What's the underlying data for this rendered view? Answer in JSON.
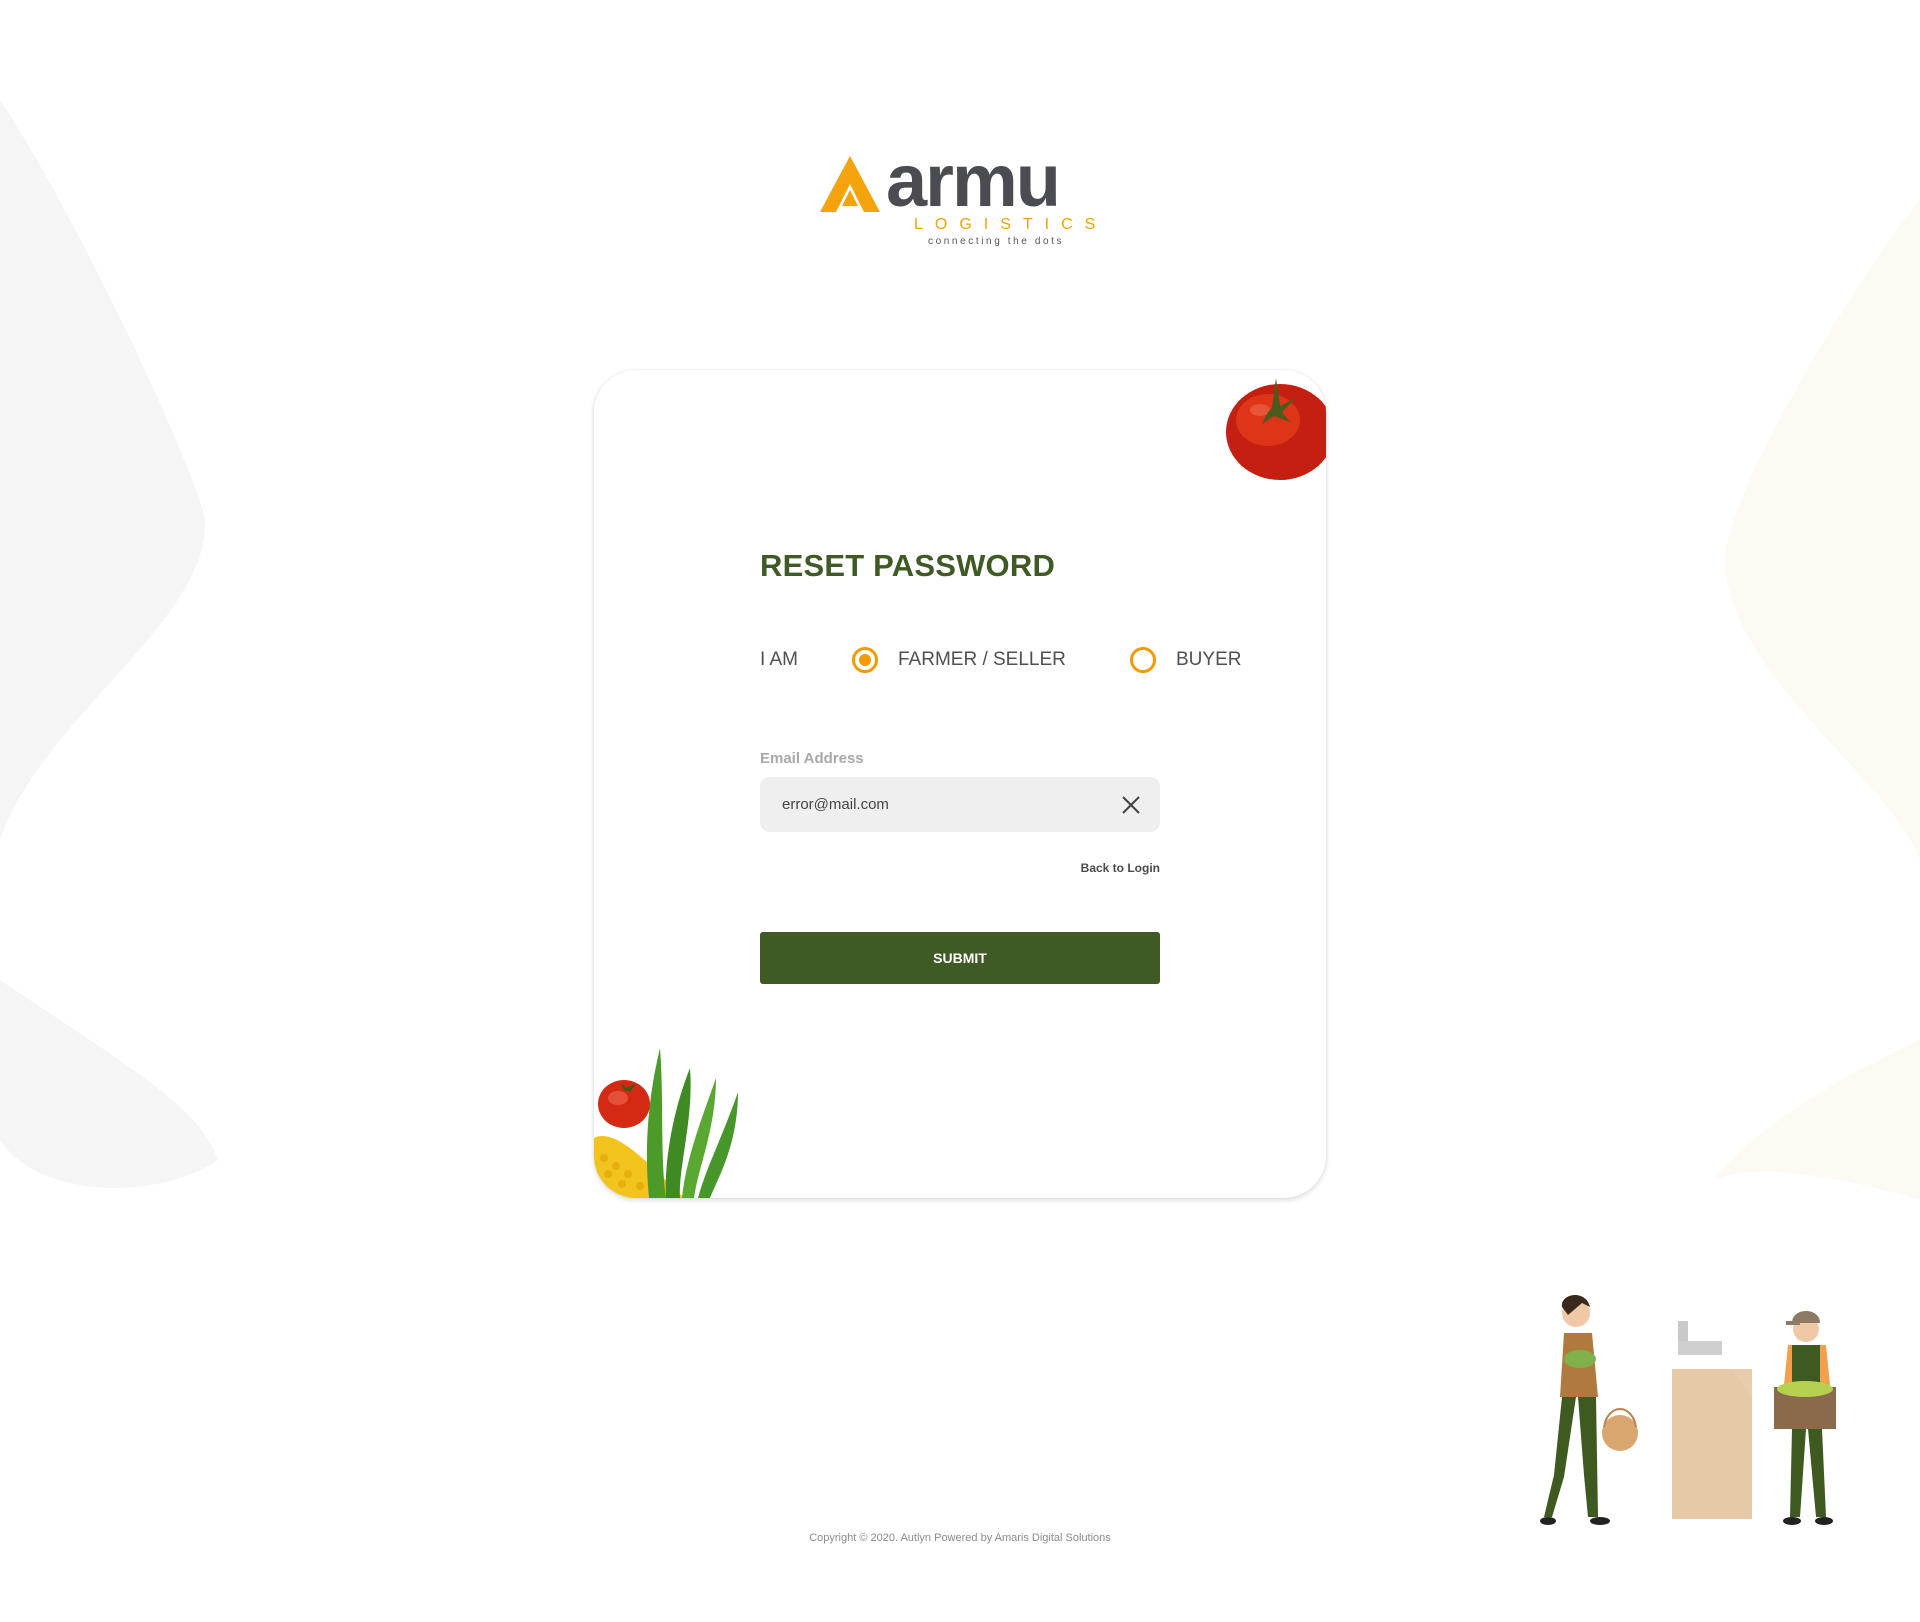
{
  "brand": {
    "name": "armu",
    "subtitle": "LOGISTICS",
    "tagline": "connecting the dots",
    "accent": "#f0a30a",
    "dark": "#4b4b52"
  },
  "form": {
    "title": "RESET PASSWORD",
    "role_label": "I AM",
    "roles": [
      {
        "label": "FARMER / SELLER",
        "selected": true
      },
      {
        "label": "BUYER",
        "selected": false
      }
    ],
    "email_label": "Email Address",
    "email_value": "error@mail.com",
    "back_link": "Back to Login",
    "submit_label": "SUBMIT"
  },
  "colors": {
    "primary": "#3f5a25",
    "radio": "#f29b05"
  },
  "footer": {
    "copyright": "Copyright © 2020. Autlyn Powered by Amaris Digital Solutions"
  }
}
